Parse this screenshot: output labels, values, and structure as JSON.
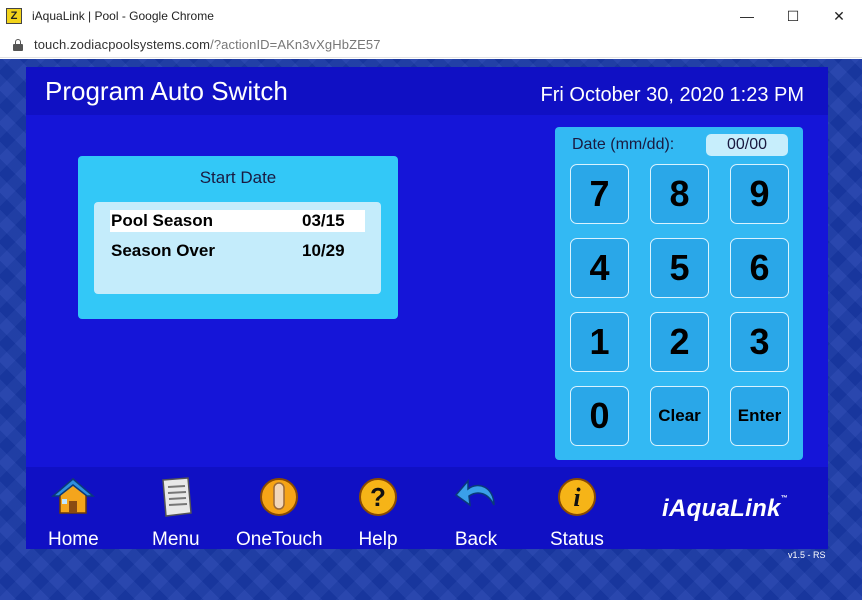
{
  "window": {
    "title": "iAquaLink | Pool - Google Chrome",
    "app_icon_letter": "Z",
    "minimize": "—",
    "maximize": "☐",
    "close": "✕"
  },
  "address": {
    "host": "touch.zodiacpoolsystems.com",
    "path": "/?actionID=AKn3vXgHbZE57"
  },
  "header": {
    "title": "Program Auto Switch",
    "datetime": "Fri October 30, 2020 1:23 PM"
  },
  "start_date": {
    "title": "Start Date",
    "rows": [
      {
        "name": "Pool Season",
        "value": "03/15",
        "selected": true
      },
      {
        "name": "Season Over",
        "value": "10/29",
        "selected": false
      }
    ]
  },
  "keypad": {
    "label": "Date (mm/dd):",
    "display": "00/00",
    "keys": [
      "7",
      "8",
      "9",
      "4",
      "5",
      "6",
      "1",
      "2",
      "3",
      "0",
      "Clear",
      "Enter"
    ]
  },
  "nav": {
    "items": [
      {
        "label": "Home",
        "icon": "home-icon"
      },
      {
        "label": "Menu",
        "icon": "menu-icon"
      },
      {
        "label": "OneTouch",
        "icon": "onetouch-icon"
      },
      {
        "label": "Help",
        "icon": "help-icon"
      },
      {
        "label": "Back",
        "icon": "back-icon"
      },
      {
        "label": "Status",
        "icon": "status-icon"
      }
    ]
  },
  "brand": {
    "name": "iAquaLink",
    "tm": "™"
  },
  "version": "v1.5 - RS",
  "colors": {
    "app_background": "#1515d8",
    "header_background": "#1010c4",
    "panel_cyan": "#33c8f7",
    "keypad_cyan": "#33b9f3"
  }
}
